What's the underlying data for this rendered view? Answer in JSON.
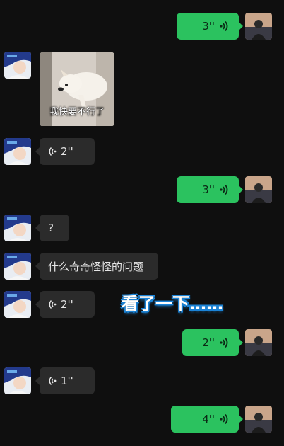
{
  "messages": [
    {
      "side": "sent",
      "kind": "voice",
      "duration": "3''"
    },
    {
      "side": "recv",
      "kind": "sticker",
      "caption": "我快要不行了"
    },
    {
      "side": "recv",
      "kind": "voice",
      "duration": "2''"
    },
    {
      "side": "sent",
      "kind": "voice",
      "duration": "3''"
    },
    {
      "side": "recv",
      "kind": "text",
      "text": "?"
    },
    {
      "side": "recv",
      "kind": "text",
      "text": "什么奇奇怪怪的问题"
    },
    {
      "side": "recv",
      "kind": "voice",
      "duration": "2''"
    },
    {
      "side": "sent",
      "kind": "voice",
      "duration": "2''"
    },
    {
      "side": "recv",
      "kind": "voice",
      "duration": "1''"
    },
    {
      "side": "sent",
      "kind": "voice",
      "duration": "4''"
    }
  ],
  "overlay_caption": "看了一下……",
  "icons": {
    "sent_voice": "voice-wave-right-icon",
    "recv_voice": "voice-wave-left-icon"
  },
  "colors": {
    "background": "#0f0f0f",
    "sent_bubble": "#2bc25f",
    "recv_bubble": "#2b2b2b",
    "caption_outline": "#1b83d6"
  }
}
